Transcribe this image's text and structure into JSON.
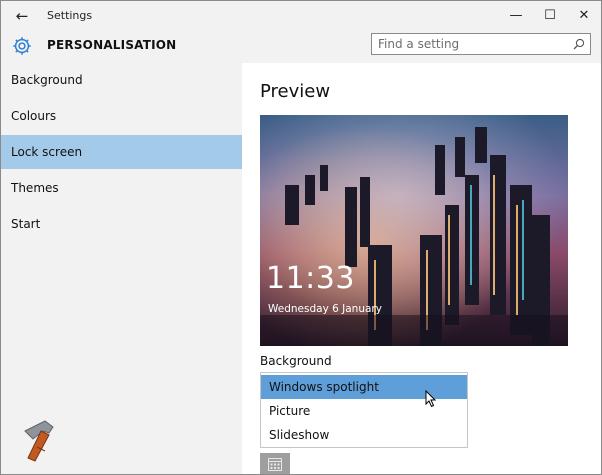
{
  "window": {
    "title": "Settings",
    "back_glyph": "←",
    "min_glyph": "—",
    "max_glyph": "☐",
    "close_glyph": "✕"
  },
  "header": {
    "title": "PERSONALISATION",
    "icon": "gear-icon"
  },
  "search": {
    "placeholder": "Find a setting",
    "icon": "search-icon"
  },
  "sidebar": {
    "items": [
      {
        "label": "Background"
      },
      {
        "label": "Colours"
      },
      {
        "label": "Lock screen",
        "active": true
      },
      {
        "label": "Themes"
      },
      {
        "label": "Start"
      }
    ]
  },
  "main": {
    "title": "Preview",
    "preview": {
      "time": "11:33",
      "date": "Wednesday 6 January"
    },
    "background_label": "Background",
    "options": [
      {
        "label": "Windows spotlight",
        "selected": true
      },
      {
        "label": "Picture"
      },
      {
        "label": "Slideshow"
      }
    ]
  },
  "colors": {
    "accent": "#5e9fd9",
    "active_nav": "#a3cae9",
    "gear": "#2a7fd4",
    "chrome": "#f2f2f2"
  }
}
